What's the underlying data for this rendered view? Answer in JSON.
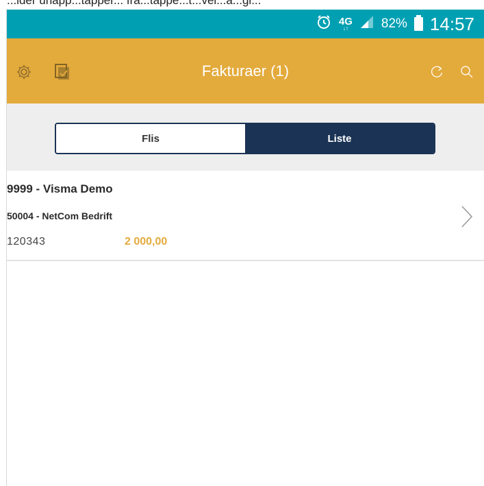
{
  "crop_text": "...lder unapp...tapper... fra...tappe...t...vei...a...gi...",
  "status_bar": {
    "network": "4G",
    "network_sub": "↓↑",
    "battery": "82%",
    "time": "14:57",
    "color": "#00a0b2"
  },
  "app_bar": {
    "title": "Fakturaer (1)",
    "color": "#e3aa3c",
    "icons": [
      "gear-icon",
      "document-check-icon",
      "refresh-icon",
      "search-icon"
    ]
  },
  "segment": {
    "options": [
      "Flis",
      "Liste"
    ],
    "selected": "Liste",
    "selected_color": "#1b3455"
  },
  "invoices": [
    {
      "company": "9999 - Visma Demo",
      "supplier": "50004 - NetCom Bedrift",
      "invoice_number": "120343",
      "amount": "2 000,00",
      "amount_color": "#e3aa3c"
    }
  ]
}
